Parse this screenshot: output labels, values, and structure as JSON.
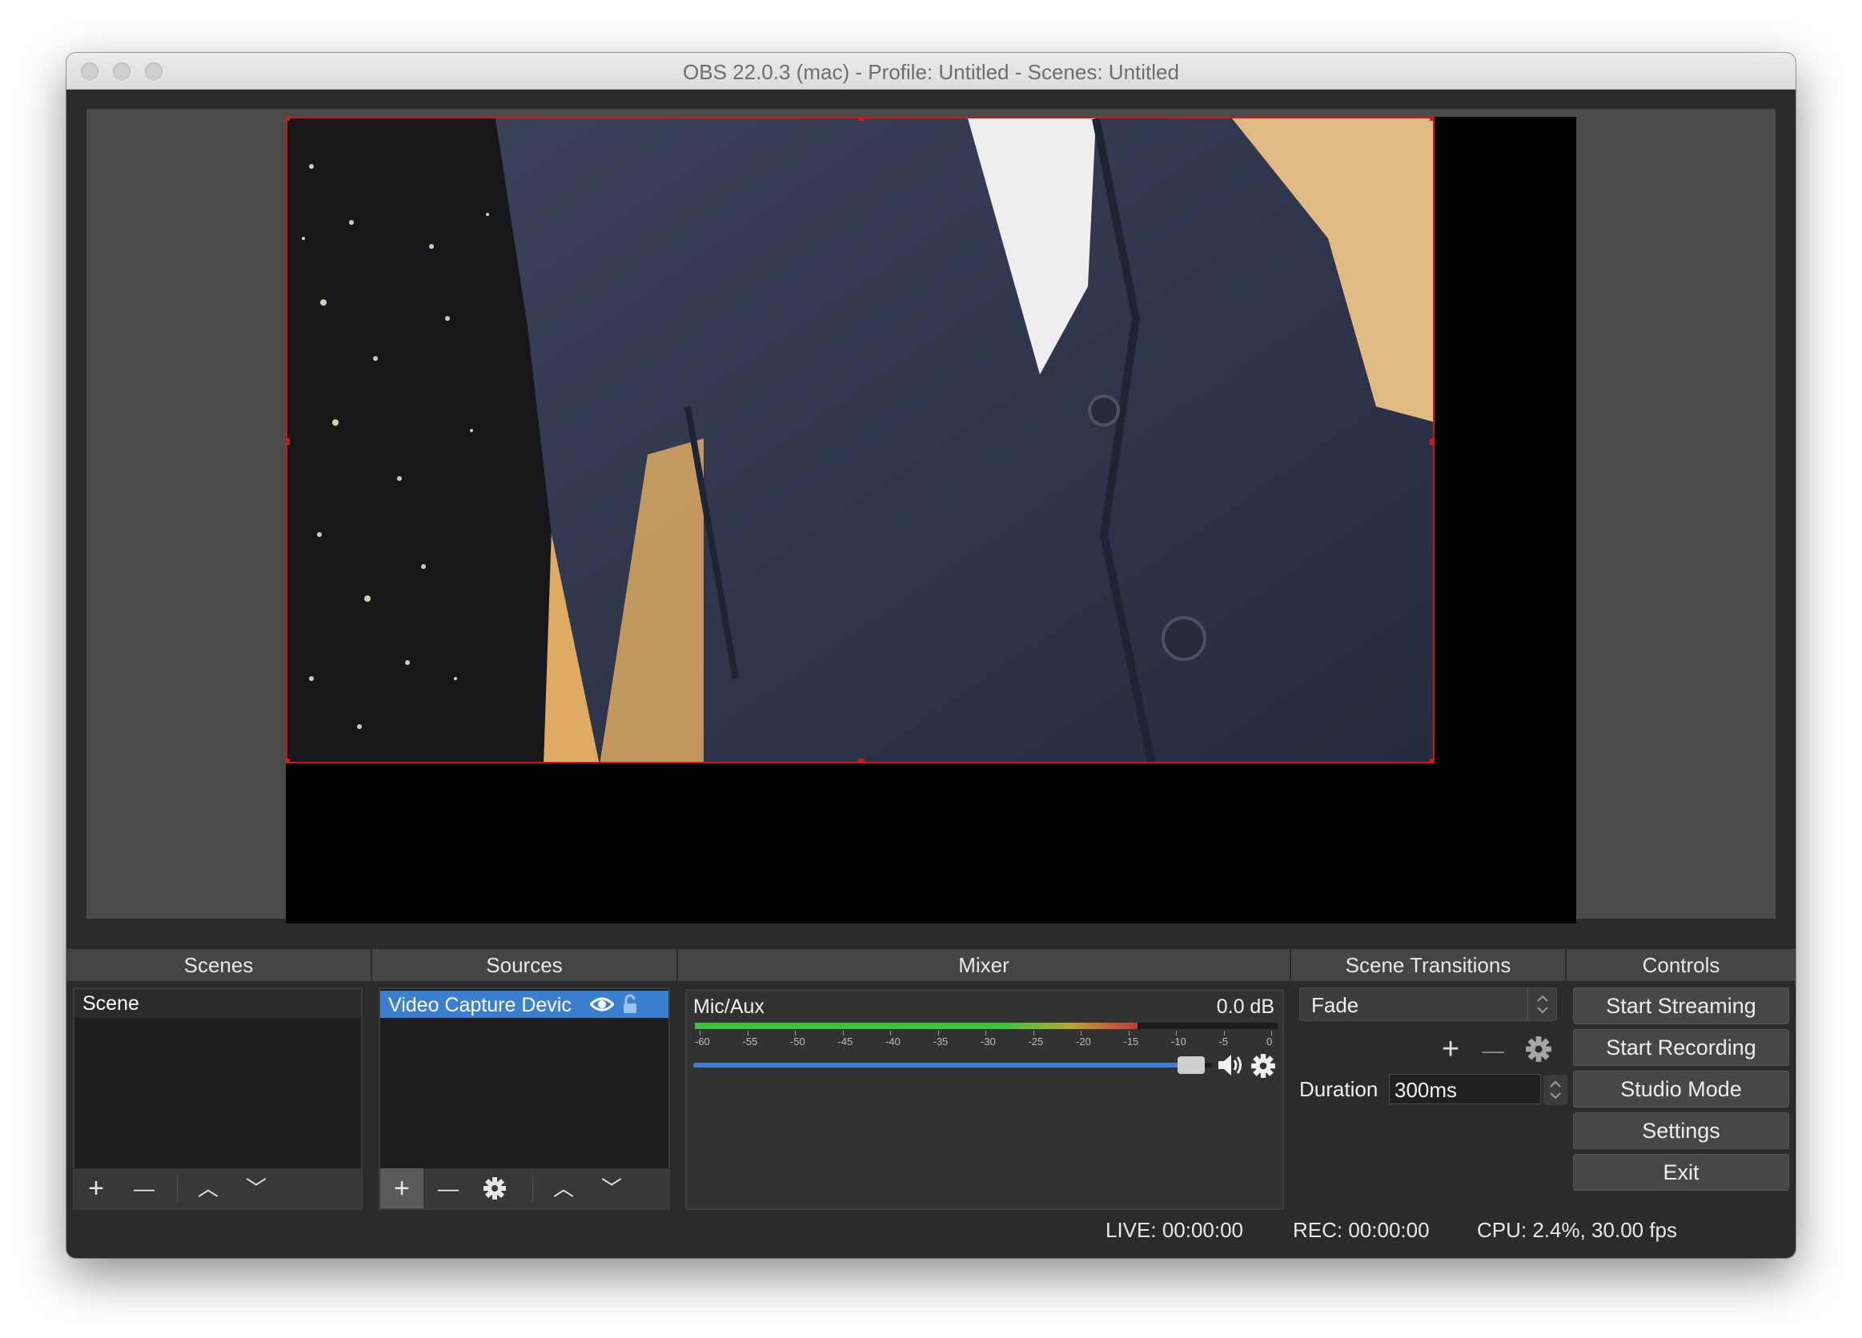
{
  "window": {
    "title": "OBS 22.0.3 (mac) - Profile: Untitled - Scenes: Untitled"
  },
  "docks": {
    "scenes": "Scenes",
    "sources": "Sources",
    "mixer": "Mixer",
    "transitions": "Scene Transitions",
    "controls": "Controls"
  },
  "scenes": {
    "items": [
      "Scene"
    ]
  },
  "sources": {
    "items": [
      {
        "label": "Video Capture Devic",
        "selected": true
      }
    ]
  },
  "mixer": {
    "channel": "Mic/Aux",
    "level": "0.0 dB",
    "volume_fraction": 0.96,
    "meter_fraction": 0.76,
    "scale": [
      "-60",
      "-55",
      "-50",
      "-45",
      "-40",
      "-35",
      "-30",
      "-25",
      "-20",
      "-15",
      "-10",
      "-5",
      "0"
    ]
  },
  "transitions": {
    "selected": "Fade",
    "duration_label": "Duration",
    "duration_value": "300ms"
  },
  "controls": {
    "start_streaming": "Start Streaming",
    "start_recording": "Start Recording",
    "studio_mode": "Studio Mode",
    "settings": "Settings",
    "exit": "Exit"
  },
  "status": {
    "live": "LIVE: 00:00:00",
    "rec": "REC: 00:00:00",
    "cpu": "CPU: 2.4%, 30.00 fps"
  },
  "icons": {
    "add": "+",
    "remove": "—",
    "up": "︿",
    "down": "﹀"
  },
  "colors": {
    "accent": "#3b7fd0",
    "meter_green": "#3fc23f",
    "meter_yellow": "#b7a731",
    "meter_red": "#c23a3a",
    "selection_border": "#d01818"
  }
}
